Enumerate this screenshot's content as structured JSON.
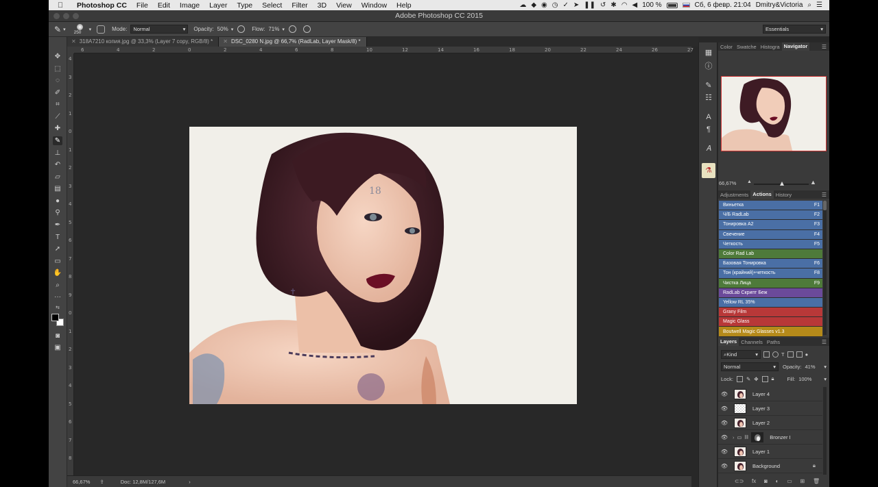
{
  "menubar": {
    "app_name": "Photoshop CC",
    "items": [
      "File",
      "Edit",
      "Image",
      "Layer",
      "Type",
      "Select",
      "Filter",
      "3D",
      "View",
      "Window",
      "Help"
    ],
    "battery": "100 %",
    "date_time": "Сб, 6 февр.  21:04",
    "user": "Dmitry&Victoria"
  },
  "window": {
    "title": "Adobe Photoshop CC 2015"
  },
  "options": {
    "brush_size": "250",
    "mode_label": "Mode:",
    "mode_value": "Normal",
    "opacity_label": "Opacity:",
    "opacity_value": "50%",
    "flow_label": "Flow:",
    "flow_value": "71%",
    "workspace": "Essentials"
  },
  "doc_tabs": [
    {
      "label": "318A7210 копия.jpg @ 33,3% (Layer 7 copy, RGB/8) *"
    },
    {
      "label": "DSC_0280 N.jpg @ 66,7% (RadLab, Layer Mask/8) *"
    }
  ],
  "ruler_h": [
    "6",
    "4",
    "2",
    "0",
    "2",
    "4",
    "6",
    "8",
    "10",
    "12",
    "14",
    "16",
    "18",
    "20",
    "22",
    "24",
    "26",
    "27"
  ],
  "ruler_v": [
    "4",
    "3",
    "2",
    "1",
    "0",
    "1",
    "2",
    "3",
    "4",
    "5",
    "6",
    "7",
    "8",
    "9",
    "0",
    "1",
    "2",
    "3",
    "4",
    "5",
    "6",
    "7",
    "8"
  ],
  "status": {
    "zoom": "66,67%",
    "doc": "Doc: 12,8M/127,6M"
  },
  "panels": {
    "top_tabs": [
      "Color",
      "Swatche",
      "Histogra",
      "Navigator"
    ],
    "zoom": "66,67%",
    "mid_tabs": [
      "Adjustments",
      "Actions",
      "History"
    ],
    "actions": [
      {
        "name": "Виньетка",
        "key": "F1",
        "color": "#4a6fa5"
      },
      {
        "name": "Ч/Б RadLab",
        "key": "F2",
        "color": "#4a6fa5"
      },
      {
        "name": "Тонировка А2",
        "key": "F3",
        "color": "#4a6fa5"
      },
      {
        "name": "Свечение",
        "key": "F4",
        "color": "#4a6fa5"
      },
      {
        "name": "Четкость",
        "key": "F5",
        "color": "#4a6fa5"
      },
      {
        "name": "Color Rad Lab",
        "key": "",
        "color": "#4e7a3a"
      },
      {
        "name": "Базовая Тонировка",
        "key": "F6",
        "color": "#4a6fa5"
      },
      {
        "name": "Тон (крайний)+четкость",
        "key": "F8",
        "color": "#4a6fa5"
      },
      {
        "name": "Чистка Лица",
        "key": "F9",
        "color": "#4e7a3a"
      },
      {
        "name": "RadLab Скрипт Беж",
        "key": "",
        "color": "#6b4a9a"
      },
      {
        "name": "Yellow RL 35%",
        "key": "",
        "color": "#4a6fa5"
      },
      {
        "name": "Grany Film",
        "key": "",
        "color": "#b83838"
      },
      {
        "name": "Magic Glass",
        "key": "",
        "color": "#b83838"
      },
      {
        "name": "Boutwell Magic Glasses v1.3",
        "key": "",
        "color": "#b58a1a"
      }
    ],
    "layer_tabs": [
      "Layers",
      "Channels",
      "Paths"
    ],
    "kind": "Kind",
    "blend": "Normal",
    "opacity_label": "Opacity:",
    "opacity_value": "41%",
    "lock_label": "Lock:",
    "fill_label": "Fill:",
    "fill_value": "100%",
    "layers": [
      {
        "name": "Layer 4",
        "thumb": "photo"
      },
      {
        "name": "Layer 3",
        "thumb": "checker"
      },
      {
        "name": "Layer 2",
        "thumb": "photo"
      },
      {
        "name": "Bronzer I",
        "thumb": "group"
      },
      {
        "name": "Layer 1",
        "thumb": "photo"
      },
      {
        "name": "Background",
        "thumb": "photo"
      }
    ]
  },
  "colors": {
    "selection_accent": "#c0392b"
  }
}
